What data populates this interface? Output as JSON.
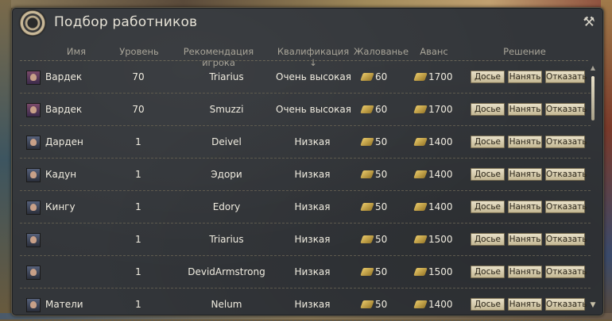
{
  "window": {
    "title": "Подбор работников",
    "tools_icon": "crossed-tools-icon"
  },
  "columns": {
    "name": "Имя",
    "level": "Уровень",
    "recommendation": "Рекомендация игрока",
    "qualification": "Квалификация ↓",
    "salary": "Жалованье",
    "advance": "Аванс",
    "decision": "Решение"
  },
  "buttons": {
    "dossier": "Досье",
    "hire": "Нанять",
    "refuse": "Отказать"
  },
  "rows": [
    {
      "name": "Вардек",
      "level": "70",
      "recommendation": "Triarius",
      "qualification": "Очень высокая",
      "salary": "60",
      "advance": "1700",
      "avatar": "red"
    },
    {
      "name": "Вардек",
      "level": "70",
      "recommendation": "Smuzzi",
      "qualification": "Очень высокая",
      "salary": "60",
      "advance": "1700",
      "avatar": "red"
    },
    {
      "name": "Дарден",
      "level": "1",
      "recommendation": "Deivel",
      "qualification": "Низкая",
      "salary": "50",
      "advance": "1400",
      "avatar": "blue"
    },
    {
      "name": "Кадун",
      "level": "1",
      "recommendation": "Эдори",
      "qualification": "Низкая",
      "salary": "50",
      "advance": "1400",
      "avatar": "blue"
    },
    {
      "name": "Кингу",
      "level": "1",
      "recommendation": "Edory",
      "qualification": "Низкая",
      "salary": "50",
      "advance": "1400",
      "avatar": "blue"
    },
    {
      "name": "",
      "level": "1",
      "recommendation": "Triarius",
      "qualification": "Низкая",
      "salary": "50",
      "advance": "1500",
      "avatar": "blue"
    },
    {
      "name": "",
      "level": "1",
      "recommendation": "DevidArmstrong",
      "qualification": "Низкая",
      "salary": "50",
      "advance": "1500",
      "avatar": "blue"
    },
    {
      "name": "Матели",
      "level": "1",
      "recommendation": "Nelum",
      "qualification": "Низкая",
      "salary": "50",
      "advance": "1400",
      "avatar": "blue"
    }
  ],
  "colors": {
    "panel": "#33363a",
    "text": "#f0ece0",
    "header_text": "#a8a498",
    "button_bg": "#e8e0c8",
    "coin": "#e8c868"
  }
}
